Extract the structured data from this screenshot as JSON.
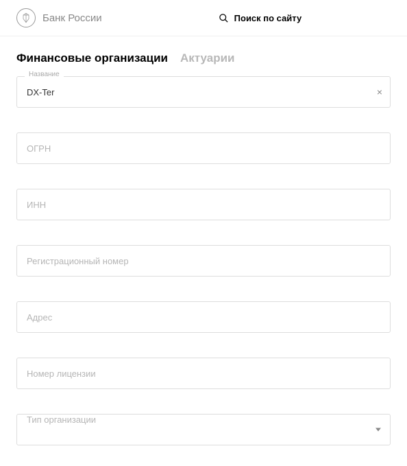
{
  "header": {
    "site_name": "Банк России",
    "search_label": "Поиск по сайту"
  },
  "tabs": {
    "active": "Финансовые организации",
    "inactive": "Актуарии"
  },
  "form": {
    "name": {
      "label": "Название",
      "value": "DX-Ter"
    },
    "ogrn": {
      "placeholder": "ОГРН"
    },
    "inn": {
      "placeholder": "ИНН"
    },
    "reg_number": {
      "placeholder": "Регистрационный номер"
    },
    "address": {
      "placeholder": "Адрес"
    },
    "license": {
      "placeholder": "Номер лицензии"
    },
    "org_type": {
      "placeholder": "Тип организации"
    }
  }
}
